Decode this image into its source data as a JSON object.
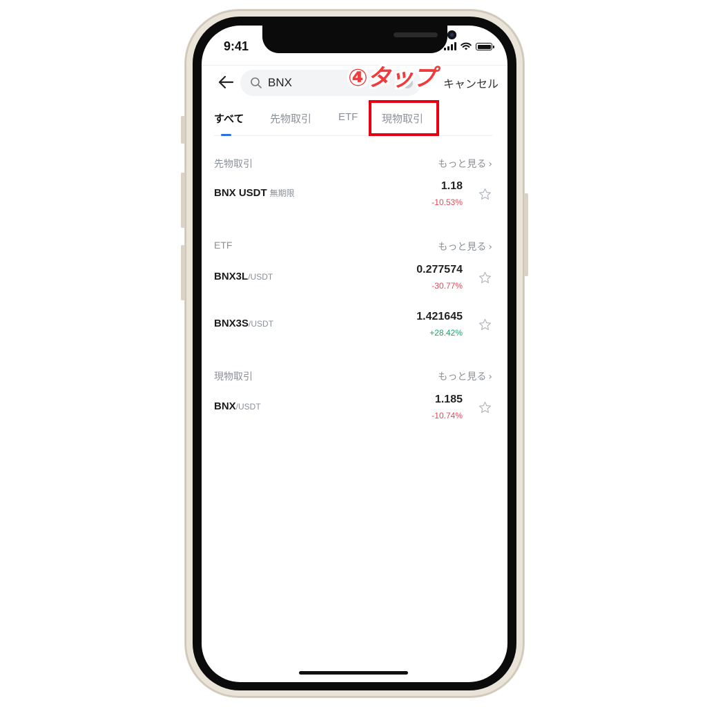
{
  "status": {
    "time": "9:41"
  },
  "search": {
    "query": "BNX",
    "cancel_label": "キャンセル"
  },
  "annotation": {
    "text": "④タップ"
  },
  "tabs": [
    {
      "label": "すべて",
      "active": true
    },
    {
      "label": "先物取引",
      "active": false
    },
    {
      "label": "ETF",
      "active": false
    },
    {
      "label": "現物取引",
      "active": false
    }
  ],
  "sections": {
    "futures": {
      "title": "先物取引",
      "more_label": "もっと見る",
      "rows": [
        {
          "symbol": "BNX USDT",
          "suffix": "",
          "tag": "無期限",
          "price": "1.18",
          "change": "-10.53%",
          "direction": "down"
        }
      ]
    },
    "etf": {
      "title": "ETF",
      "more_label": "もっと見る",
      "rows": [
        {
          "symbol": "BNX3L",
          "suffix": "/USDT",
          "tag": "",
          "price": "0.277574",
          "change": "-30.77%",
          "direction": "down"
        },
        {
          "symbol": "BNX3S",
          "suffix": "/USDT",
          "tag": "",
          "price": "1.421645",
          "change": "+28.42%",
          "direction": "up"
        }
      ]
    },
    "spot": {
      "title": "現物取引",
      "more_label": "もっと見る",
      "rows": [
        {
          "symbol": "BNX",
          "suffix": "/USDT",
          "tag": "",
          "price": "1.185",
          "change": "-10.74%",
          "direction": "down"
        }
      ]
    }
  },
  "icons": {
    "back": "back-arrow-icon",
    "search": "search-icon",
    "clear": "clear-icon",
    "star": "star-icon",
    "more": "chevron-right-icon"
  },
  "colors": {
    "negative": "#e04a5a",
    "positive": "#1aa66a",
    "annotation": "#ef3b3b",
    "highlight_border": "#e60012",
    "tab_indicator": "#2f6fe0"
  }
}
